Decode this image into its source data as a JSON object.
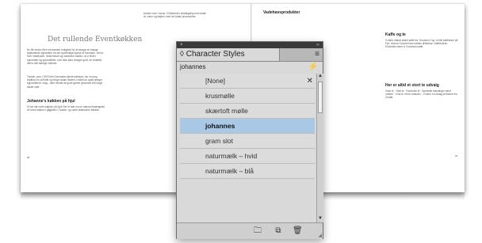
{
  "document": {
    "left_page": {
      "title": "Det rullende Eventkøkken",
      "intro": "Nu får endnu flere mennesker mulighed for at smage de mange spændende egnsretter fra det sydvestlige hjørne af Danmark. Det er hver Vadehavet, Vesterhavet og marskens madeo, at vi finder egnsretter og specialiteter, som ikke bare smager godt, de fortæller derns helt særlige historier.",
      "para2": "Tønder, som i 1920 blev Danmarks første købstad, har en lang tradition for at finde og bruge lokale råvarer, hvilket du også præger egnsretterne i dag – ikke mindst de gode gamle johannes af mange lokale cafe.",
      "sub": "Johanne's køkken på hjul",
      "para3": "Vi har sat vores køkken på hjul! Der er tale om en natural forlængelse af vores køkken i gågaden i Tønder, og vores stationære køkken.",
      "col2": "kvelser som i fokus. Vi tilbereder selvfølgelig med lokale rå- varer og køyber med de lokale producenter.",
      "page_number": "26"
    },
    "right_page": {
      "h_left": "Vadehavsprodukter",
      "h_right1": "Kaffe og te",
      "text_right1": "Vi fører blandt andet kaffe fra: Giovanni Cup, et lille kaffeleder på Fyn. Mocca Gourmet kan kaldes drikkekar i kaffebrænn. Endvidere fører vi Colombia kaffe.",
      "h_right2": "Her er altid et stort te udvalg",
      "text_right2": "Grøn te · Hvid te · Rooibush te · Specielle blandinger samt urtetee · Chai te i flere varianter · Vi fører et udvalg af teserie fra Chatte.",
      "page_number": "27"
    }
  },
  "panel": {
    "title_close": "×",
    "title_collapse": "‹‹",
    "tab_label": "◊ Character Styles",
    "menu_icon": "≡",
    "selected_style": "johannes",
    "bolt_icon": "⚡",
    "styles": [
      "[None]",
      "krusmølle",
      "skærtoft mølle",
      "johannes",
      "gram slot",
      "naturmælk – hvid",
      "naturmælk – blå"
    ],
    "selected_index": 3,
    "none_icon": "✕",
    "scroll_up": "▲",
    "scroll_down": "▼",
    "footer_icons": [
      "folder-icon",
      "new-style-icon",
      "trash-icon"
    ],
    "footer_glyphs": [
      "🗀",
      "⧉",
      "🗑"
    ]
  }
}
